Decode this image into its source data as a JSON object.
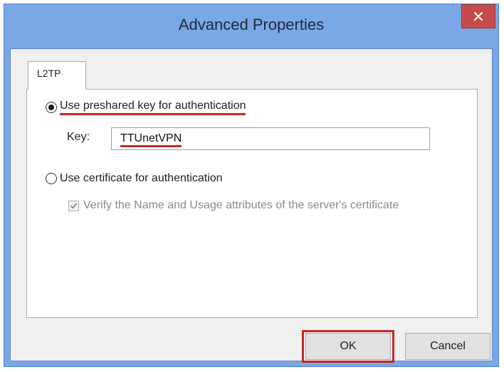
{
  "window": {
    "title": "Advanced Properties",
    "close_icon": "close-icon"
  },
  "tabs": [
    {
      "label": "L2TP",
      "selected": true
    }
  ],
  "auth": {
    "preshared_label": "Use preshared key for authentication",
    "preshared_selected": true,
    "key_label": "Key:",
    "key_value": "TTUnetVPN",
    "certificate_label": "Use certificate for authentication",
    "certificate_selected": false,
    "verify_label": "Verify the Name and Usage attributes of the server's certificate",
    "verify_checked": true,
    "verify_disabled": true
  },
  "buttons": {
    "ok_label": "OK",
    "cancel_label": "Cancel"
  },
  "colors": {
    "highlight": "#c62828",
    "frame": "#7aa8e6",
    "close": "#c74b4b"
  }
}
